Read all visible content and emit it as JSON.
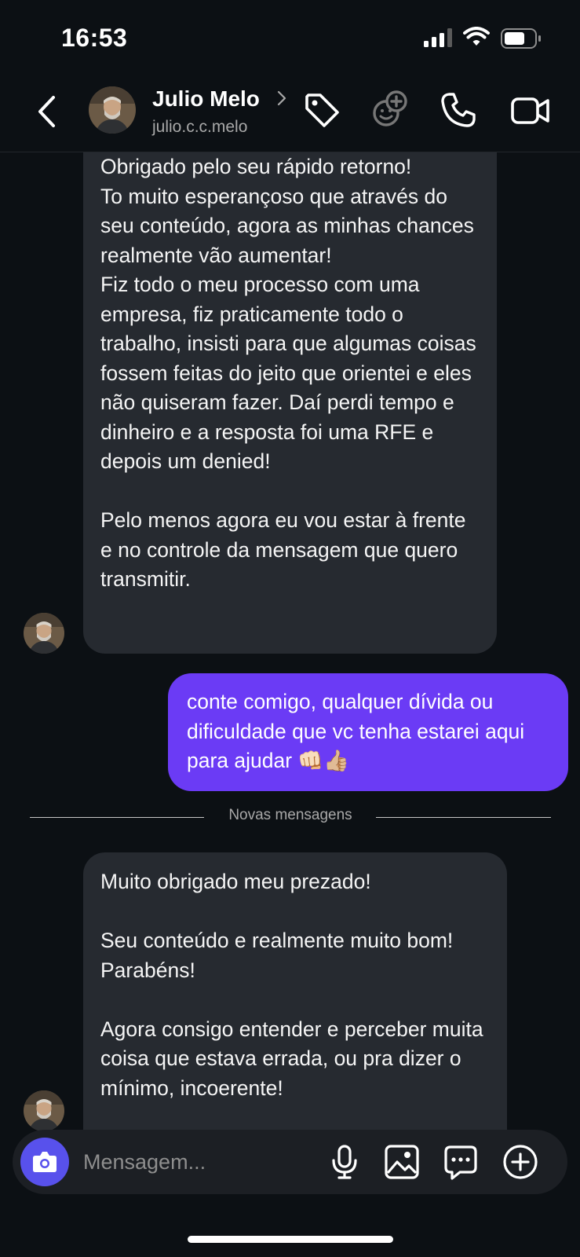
{
  "status_bar": {
    "time": "16:53"
  },
  "header": {
    "contact_name": "Julio Melo",
    "username": "julio.c.c.melo"
  },
  "messages": [
    {
      "direction": "incoming",
      "text": "Obrigado pelo seu rápido retorno!\nTo muito esperançoso que através do seu conteúdo, agora as minhas chances realmente vão aumentar!\nFiz todo o meu processo com uma empresa, fiz praticamente todo o trabalho, insisti para que algumas coisas fossem feitas do jeito que orientei e eles não quiseram fazer. Daí perdi tempo e dinheiro e a resposta foi uma RFE e depois um denied!\n\nPelo menos agora eu vou estar à frente e no controle da mensagem que quero transmitir."
    },
    {
      "direction": "outgoing",
      "text": "conte comigo, qualquer dívida ou dificuldade que vc tenha estarei aqui para ajudar 👊🏻👍🏼"
    },
    {
      "direction": "incoming",
      "text": "Muito obrigado meu prezado!\n\nSeu conteúdo e realmente muito bom! Parabéns!\n\nAgora consigo entender e perceber muita coisa que estava errada, ou pra dizer o mínimo, incoerente!"
    }
  ],
  "divider_label": "Novas mensagens",
  "composer": {
    "placeholder": "Mensagem..."
  },
  "colors": {
    "background": "#0c1014",
    "incoming_bubble": "#262a30",
    "outgoing_bubble": "#6b3bf5",
    "camera_button": "#5851ec"
  }
}
